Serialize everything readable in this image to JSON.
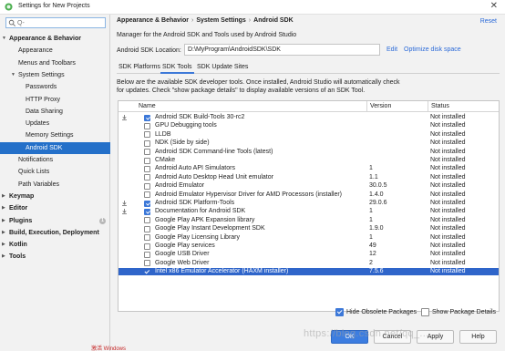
{
  "window": {
    "title": "Settings for New Projects",
    "close_glyph": "✕"
  },
  "search": {
    "placeholder": "Q-",
    "value": ""
  },
  "sidebar": {
    "items": [
      {
        "label": "Appearance & Behavior",
        "bold": true,
        "expanded": true
      },
      {
        "label": "Appearance"
      },
      {
        "label": "Menus and Toolbars"
      },
      {
        "label": "System Settings",
        "expanded": true
      },
      {
        "label": "Passwords"
      },
      {
        "label": "HTTP Proxy"
      },
      {
        "label": "Data Sharing"
      },
      {
        "label": "Updates"
      },
      {
        "label": "Memory Settings"
      },
      {
        "label": "Android SDK",
        "selected": true
      },
      {
        "label": "Notifications"
      },
      {
        "label": "Quick Lists"
      },
      {
        "label": "Path Variables"
      },
      {
        "label": "Keymap",
        "bold": true
      },
      {
        "label": "Editor",
        "bold": true
      },
      {
        "label": "Plugins",
        "bold": true,
        "badge": "1"
      },
      {
        "label": "Build, Execution, Deployment",
        "bold": true
      },
      {
        "label": "Kotlin",
        "bold": true
      },
      {
        "label": "Tools",
        "bold": true
      }
    ]
  },
  "breadcrumb": [
    "Appearance & Behavior",
    "System Settings",
    "Android SDK"
  ],
  "breadcrumb_sep": "›",
  "reset_label": "Reset",
  "description": "Manager for the Android SDK and Tools used by Android Studio",
  "sdk_location": {
    "label": "Android SDK Location:",
    "value": "D:\\MyProgram\\AndroidSDK\\SDK",
    "edit_label": "Edit",
    "optimize_label": "Optimize disk space"
  },
  "tabs": [
    "SDK Platforms",
    "SDK Tools",
    "SDK Update Sites"
  ],
  "active_tab": 1,
  "info_lines": [
    "Below are the available SDK developer tools. Once installed, Android Studio will automatically check",
    "for updates. Check \"show package details\" to display available versions of an SDK Tool."
  ],
  "table": {
    "columns": [
      "Name",
      "Version",
      "Status"
    ],
    "rows": [
      {
        "name": "Android SDK Build-Tools 30-rc2",
        "version": "",
        "status": "Not installed",
        "checked": true,
        "download": true
      },
      {
        "name": "GPU Debugging tools",
        "version": "",
        "status": "Not installed",
        "checked": false
      },
      {
        "name": "LLDB",
        "version": "",
        "status": "Not installed",
        "checked": false
      },
      {
        "name": "NDK (Side by side)",
        "version": "",
        "status": "Not installed",
        "checked": false
      },
      {
        "name": "Android SDK Command-line Tools (latest)",
        "version": "",
        "status": "Not installed",
        "checked": false
      },
      {
        "name": "CMake",
        "version": "",
        "status": "Not installed",
        "checked": false
      },
      {
        "name": "Android Auto API Simulators",
        "version": "1",
        "status": "Not installed",
        "checked": false
      },
      {
        "name": "Android Auto Desktop Head Unit emulator",
        "version": "1.1",
        "status": "Not installed",
        "checked": false
      },
      {
        "name": "Android Emulator",
        "version": "30.0.5",
        "status": "Not installed",
        "checked": false
      },
      {
        "name": "Android Emulator Hypervisor Driver for AMD Processors (installer)",
        "version": "1.4.0",
        "status": "Not installed",
        "checked": false
      },
      {
        "name": "Android SDK Platform-Tools",
        "version": "29.0.6",
        "status": "Not installed",
        "checked": true,
        "download": true
      },
      {
        "name": "Documentation for Android SDK",
        "version": "1",
        "status": "Not installed",
        "checked": true,
        "download": true
      },
      {
        "name": "Google Play APK Expansion library",
        "version": "1",
        "status": "Not installed",
        "checked": false
      },
      {
        "name": "Google Play Instant Development SDK",
        "version": "1.9.0",
        "status": "Not installed",
        "checked": false
      },
      {
        "name": "Google Play Licensing Library",
        "version": "1",
        "status": "Not installed",
        "checked": false
      },
      {
        "name": "Google Play services",
        "version": "49",
        "status": "Not installed",
        "checked": false
      },
      {
        "name": "Google USB Driver",
        "version": "12",
        "status": "Not installed",
        "checked": false
      },
      {
        "name": "Google Web Driver",
        "version": "2",
        "status": "Not installed",
        "checked": false
      },
      {
        "name": "Intel x86 Emulator Accelerator (HAXM installer)",
        "version": "7.5.6",
        "status": "Not installed",
        "checked": true,
        "selected": true
      }
    ]
  },
  "options": {
    "hide_obsolete": {
      "label": "Hide Obsolete Packages",
      "checked": true
    },
    "show_details": {
      "label": "Show Package Details",
      "checked": false
    }
  },
  "buttons": {
    "ok": "OK",
    "cancel": "Cancel",
    "apply": "Apply",
    "help": "Help"
  },
  "watermark": "https://blog.csdn.net/qq_...",
  "footnote": "激活 Windows",
  "colors": {
    "accent": "#3c78d8",
    "selection": "#2470c9",
    "link": "#2b6ad8"
  }
}
